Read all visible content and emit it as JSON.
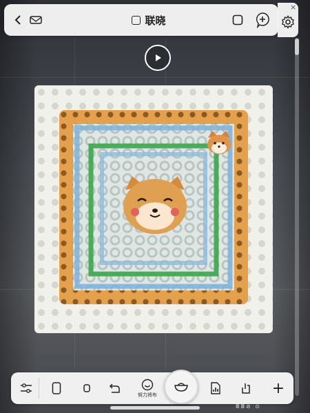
{
  "header": {
    "title": "联晓",
    "back_icon": "chevron-left-icon",
    "mail_icon": "mail-icon",
    "square_icon": "square-icon",
    "add_icon": "plus-circle-icon",
    "settings_icon": "gear-icon",
    "close_label": "×"
  },
  "media": {
    "play_icon": "play-icon"
  },
  "toolbar": {
    "items": [
      {
        "icon": "sliders-icon",
        "label": ""
      },
      {
        "icon": "phone-icon",
        "label": ""
      },
      {
        "icon": "small-square-icon",
        "label": ""
      },
      {
        "icon": "rotate-icon",
        "label": ""
      },
      {
        "icon": "smile-icon",
        "label": "努力将布"
      },
      {
        "icon": "bowl-icon",
        "label": ""
      },
      {
        "icon": "chart-doc-icon",
        "label": ""
      },
      {
        "icon": "share-icon",
        "label": ""
      },
      {
        "icon": "plus-icon",
        "label": "+"
      }
    ]
  },
  "status_bar": {
    "text": "ⅢⅢ⊘ ⊙"
  },
  "colors": {
    "bar_bg": "#f6f6f6",
    "border_orange": "#e6a04a",
    "inner_blue": "#7fb2d8",
    "green": "#3aa64a",
    "board_white": "#f1f1ec"
  }
}
